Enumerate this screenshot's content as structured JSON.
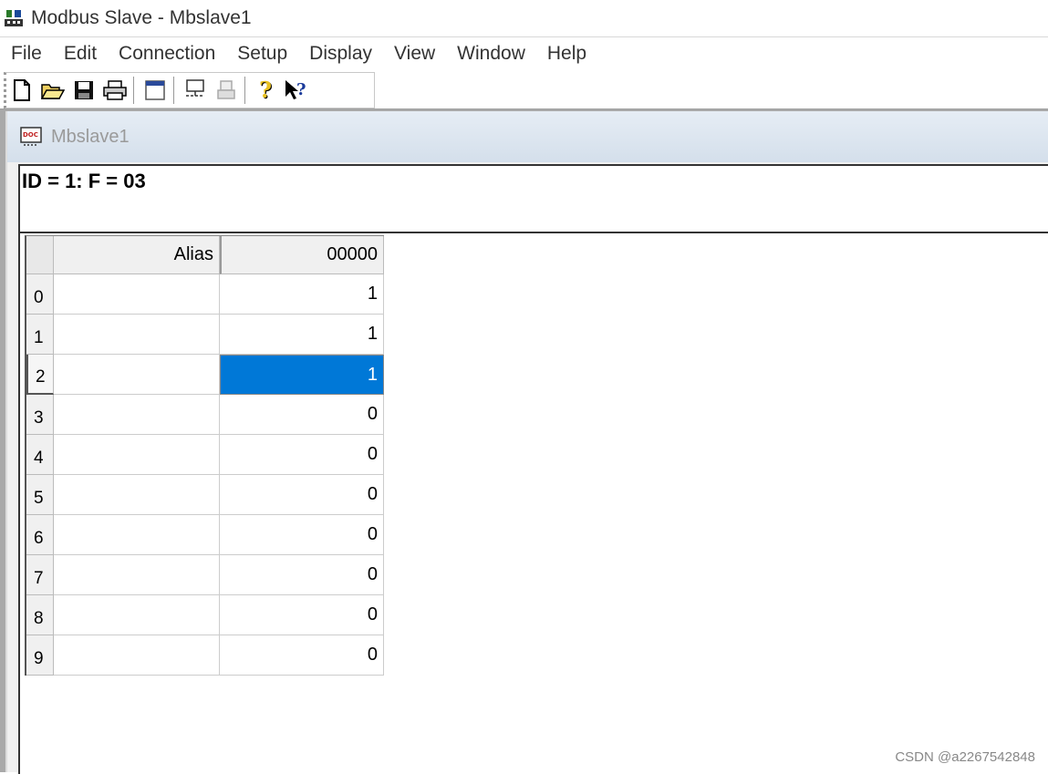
{
  "window": {
    "title": "Modbus Slave - Mbslave1",
    "app_icon": "modbus-slave-icon"
  },
  "menu": [
    "File",
    "Edit",
    "Connection",
    "Setup",
    "Display",
    "View",
    "Window",
    "Help"
  ],
  "toolbar": {
    "buttons": [
      "new-icon",
      "open-icon",
      "save-icon",
      "print-icon",
      "window-icon",
      "connect-icon",
      "disconnect-icon",
      "help-icon",
      "context-help-icon"
    ]
  },
  "child": {
    "title": "Mbslave1",
    "info": "ID = 1: F = 03",
    "columns": {
      "alias": "Alias",
      "register": "00000"
    },
    "rows": [
      {
        "index": "0",
        "alias": "",
        "value": "1"
      },
      {
        "index": "1",
        "alias": "",
        "value": "1"
      },
      {
        "index": "2",
        "alias": "",
        "value": "1",
        "selected": true
      },
      {
        "index": "3",
        "alias": "",
        "value": "0"
      },
      {
        "index": "4",
        "alias": "",
        "value": "0"
      },
      {
        "index": "5",
        "alias": "",
        "value": "0"
      },
      {
        "index": "6",
        "alias": "",
        "value": "0"
      },
      {
        "index": "7",
        "alias": "",
        "value": "0"
      },
      {
        "index": "8",
        "alias": "",
        "value": "0"
      },
      {
        "index": "9",
        "alias": "",
        "value": "0"
      }
    ]
  },
  "watermark": "CSDN @a2267542848",
  "colors": {
    "selection": "#0078d7"
  }
}
